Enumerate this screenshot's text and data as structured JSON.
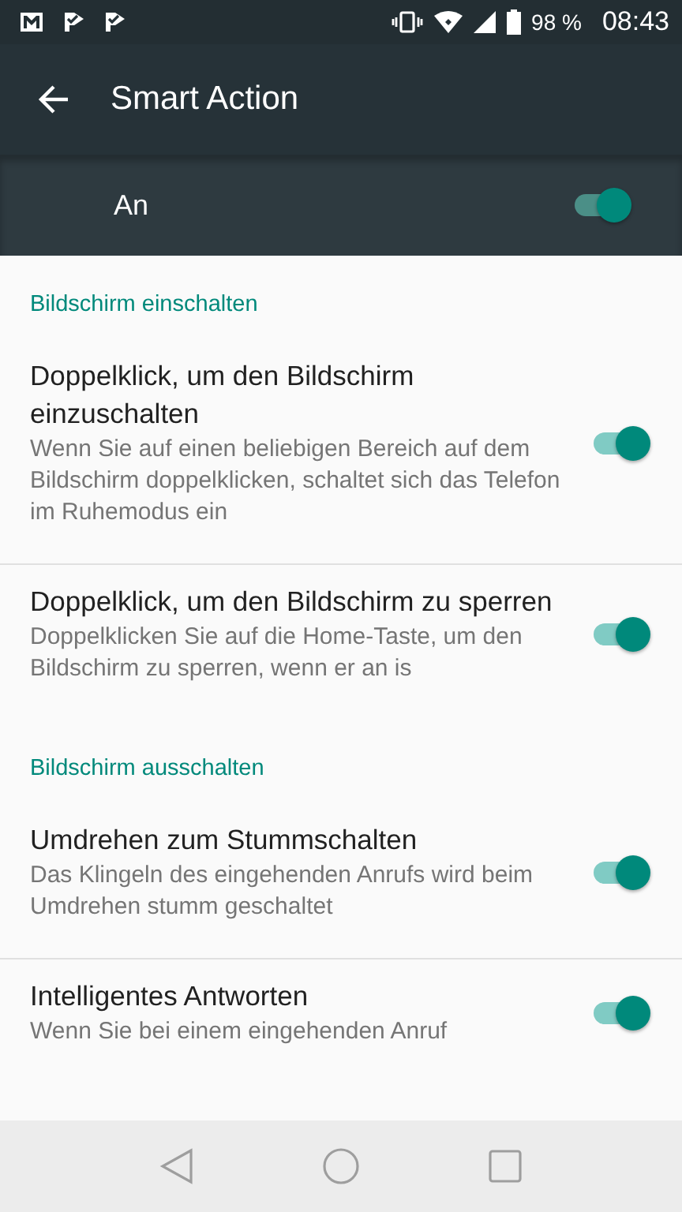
{
  "status_bar": {
    "battery": "98 %",
    "time": "08:43"
  },
  "toolbar": {
    "title": "Smart Action"
  },
  "master_switch": {
    "label": "An",
    "on": true
  },
  "sections": [
    {
      "header": "Bildschirm einschalten",
      "items": [
        {
          "title": "Doppelklick, um den Bildschirm einzuschalten",
          "summary": "Wenn Sie auf einen beliebigen Bereich auf dem Bildschirm doppelklicken, schaltet sich das Telefon im Ruhemodus ein",
          "on": true
        },
        {
          "title": "Doppelklick, um den Bildschirm zu sperren",
          "summary": "Doppelklicken Sie auf die Home-Taste, um den Bildschirm zu sperren, wenn er an is",
          "on": true
        }
      ]
    },
    {
      "header": "Bildschirm ausschalten",
      "items": [
        {
          "title": "Umdrehen zum Stummschalten",
          "summary": "Das Klingeln des eingehenden Anrufs wird beim Umdrehen stumm geschaltet",
          "on": true
        },
        {
          "title": "Intelligentes Antworten",
          "summary": "Wenn Sie bei einem eingehenden Anruf",
          "on": true
        }
      ]
    }
  ]
}
